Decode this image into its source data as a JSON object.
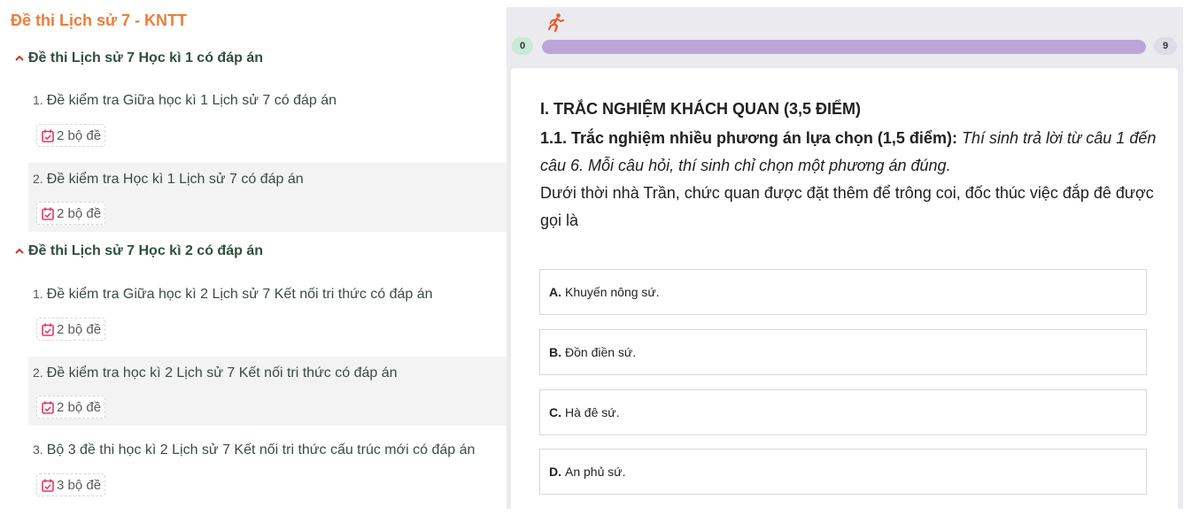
{
  "page_title": "Đề thi Lịch sử 7 - KNTT",
  "sections": [
    {
      "title": "Đề thi Lịch sử 7 Học kì 1 có đáp án",
      "items": [
        {
          "num": "1.",
          "title": "Đề kiểm tra Giữa học kì 1 Lịch sử 7 có đáp án",
          "badge": "2 bộ đề"
        },
        {
          "num": "2.",
          "title": "Đề kiểm tra Học kì 1 Lịch sử 7 có đáp án",
          "badge": "2 bộ đề"
        }
      ]
    },
    {
      "title": "Đề thi Lịch sử 7 Học kì 2 có đáp án",
      "items": [
        {
          "num": "1.",
          "title": "Đề kiểm tra Giữa học kì 2 Lịch sử 7 Kết nối tri thức có đáp án",
          "badge": "2 bộ đề"
        },
        {
          "num": "2.",
          "title": "Đề kiểm tra học kì 2 Lịch sử 7 Kết nối tri thức có đáp án",
          "badge": "2 bộ đề"
        },
        {
          "num": "3.",
          "title": "Bộ 3 đề thi học kì 2 Lịch sử 7 Kết nối tri thức cấu trúc mới có đáp án",
          "badge": "3 bộ đề"
        }
      ]
    }
  ],
  "progress": {
    "start": "0",
    "end": "9",
    "fill_fraction": 1.0,
    "icon": "runner-icon"
  },
  "question": {
    "heading": "I. TRẮC NGHIỆM KHÁCH QUAN (3,5 ĐIỂM)",
    "sub_bold": "1.1. Trắc nghiệm nhiều phương án lựa chọn (1,5 điểm):",
    "sub_italic": "Thí sinh trả lời từ câu 1 đến câu 6. Mỗi câu hỏi, thí sinh chỉ chọn một phương án đúng.",
    "text": "Dưới thời nhà Trần, chức quan được đặt thêm để trông coi, đốc thúc việc đắp đê được gọi là",
    "options": [
      {
        "letter": "A.",
        "text": "Khuyến nông sứ."
      },
      {
        "letter": "B.",
        "text": "Đồn điền sứ."
      },
      {
        "letter": "C.",
        "text": "Hà đê sứ."
      },
      {
        "letter": "D.",
        "text": "An phủ sứ."
      }
    ]
  },
  "colors": {
    "accent_orange": "#ee7d3a",
    "section_green": "#2f4f3f",
    "chevron_red": "#c0392b",
    "badge_icon": "#e8365d",
    "progress_fill": "#bba4d6"
  }
}
